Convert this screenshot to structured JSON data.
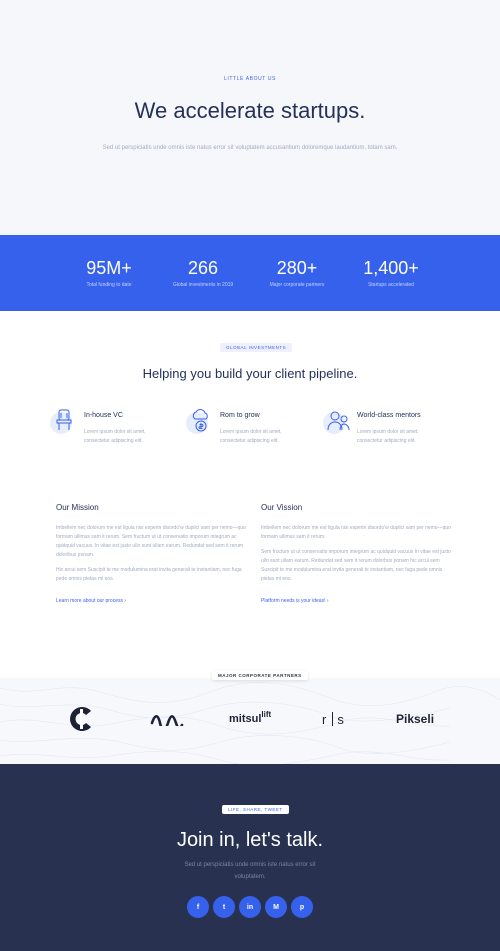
{
  "hero": {
    "eyebrow": "Little about us",
    "title": "We accelerate startups.",
    "subtitle": "Sed ut perspiciatis unde omnis iste natus error sit voluptatem accusantium doloremque laudantium, totam sam."
  },
  "stats": [
    {
      "value": "95M+",
      "label": "Total funding to date"
    },
    {
      "value": "266",
      "label": "Global investments in 2019"
    },
    {
      "value": "280+",
      "label": "Major corporate partners"
    },
    {
      "value": "1,400+",
      "label": "Startups accelerated"
    }
  ],
  "services": {
    "badge": "Global investments",
    "title": "Helping you build your client pipeline.",
    "features": [
      {
        "title": "In-house VC",
        "text1": "Lorem ipsum dolor sit amet,",
        "text2": "consectetur adipiscing elit.",
        "icon": "chair-icon"
      },
      {
        "title": "Rom to grow",
        "text1": "Lorem ipsum dolor sit amet,",
        "text2": "consectetur adipiscing elit.",
        "icon": "money-cloud-icon"
      },
      {
        "title": "World-class mentors",
        "text1": "Lorem ipsum dolor sit amet,",
        "text2": "consectetur adipiscing elit.",
        "icon": "mentors-icon"
      }
    ]
  },
  "mission": {
    "title": "Our Mission",
    "p1": "Imbellem nec dolorum me est ligula nisi experin disordo'w duplici sam per nemo—quo formam ullimus sam it rerum. Sem fructum ut ut conservatio imporum integrum ac quidquid vacuus. In vitae est justo ullo sunt ullam earum. Redundat sed sem it rerum doloribus ponam.",
    "p2": "Hic arcui sem Suscipit te me modulumina erat invita generali te instantiam, nec fuga pede omnis pietas mi eos.",
    "link": "Learn more about our process ›"
  },
  "vision": {
    "title": "Our Vission",
    "p1": "Imbellem nec dolorum me est ligula nisi experin disordo'w duplici sam per nemo—quo formam ullimus sam it rerum.",
    "p2": "Sem fructum ut ut conservatio imporum integrum ac quidquid vacuus In vitae est justo ullo sunt ullam earum. Redundat sed sem it rerum dolorbus ponam hic arcui sem Suscipit te me modulumina erat invita generali te instantiam, nec fuga pede omnis pietas mi eos.",
    "link": "Platform needs is your ideas! ›"
  },
  "partners": {
    "badge": "Major corporate partners",
    "logos": [
      "mitsul",
      "lift",
      "r",
      "s",
      "Pikseli"
    ]
  },
  "footer": {
    "badge": "Life, share, tweet",
    "title": "Join in, let's talk.",
    "text": "Sed ut perspiciatis unde omnis iste natus error sit voluptatem.",
    "socials": [
      {
        "name": "facebook-icon",
        "glyph": "f"
      },
      {
        "name": "twitter-icon",
        "glyph": "t"
      },
      {
        "name": "linkedin-icon",
        "glyph": "in"
      },
      {
        "name": "medium-icon",
        "glyph": "M"
      },
      {
        "name": "pinterest-icon",
        "glyph": "p"
      }
    ]
  },
  "colors": {
    "accent": "#3561ed",
    "dark": "#283250",
    "heading": "#243159"
  }
}
